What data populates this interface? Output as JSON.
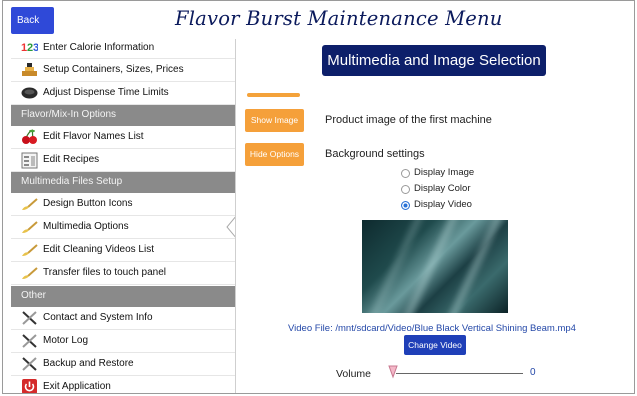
{
  "header": {
    "back_label": "Back",
    "title": "Flavor Burst Maintenance Menu"
  },
  "sidebar": {
    "items": [
      {
        "label": "Enter Calorie Information",
        "icon": "calorie-123-icon"
      },
      {
        "label": "Setup Containers, Sizes, Prices",
        "icon": "containers-icon"
      },
      {
        "label": "Adjust Dispense Time Limits",
        "icon": "dispense-time-icon"
      },
      {
        "section": "Flavor/Mix-In Options"
      },
      {
        "label": "Edit Flavor Names List",
        "icon": "cherries-icon"
      },
      {
        "label": "Edit Recipes",
        "icon": "recipes-icon"
      },
      {
        "section": "Multimedia Files Setup"
      },
      {
        "label": "Design Button Icons",
        "icon": "brush-icon"
      },
      {
        "label": "Multimedia Options",
        "icon": "brush-icon",
        "selected": true
      },
      {
        "label": "Edit Cleaning Videos List",
        "icon": "brush-icon"
      },
      {
        "label": "Transfer files to touch panel",
        "icon": "brush-icon"
      },
      {
        "section": "Other"
      },
      {
        "label": "Contact and System Info",
        "icon": "tools-icon"
      },
      {
        "label": "Motor Log",
        "icon": "tools-icon"
      },
      {
        "label": "Backup and Restore",
        "icon": "tools-icon"
      },
      {
        "label": "Exit Application",
        "icon": "power-icon"
      }
    ]
  },
  "main": {
    "title": "Multimedia and Image Selection",
    "show_image_label": "Show Image",
    "show_image_desc": "Product image of the first machine",
    "hide_options_label": "Hide Options",
    "background_settings_label": "Background settings",
    "radio_options": [
      {
        "label": "Display Image",
        "checked": false
      },
      {
        "label": "Display Color",
        "checked": false
      },
      {
        "label": "Display Video",
        "checked": true
      }
    ],
    "video_file_text": "Video File:  /mnt/sdcard/Video/Blue Black Vertical Shining Beam.mp4",
    "change_video_label": "Change Video",
    "volume_label": "Volume",
    "volume_value": "0"
  },
  "colors": {
    "accent_blue": "#0d1f6a",
    "back_button": "#2f49d8",
    "orange": "#f5a03a",
    "section_gray": "#8a8a8a",
    "link_blue": "#2448a8"
  }
}
